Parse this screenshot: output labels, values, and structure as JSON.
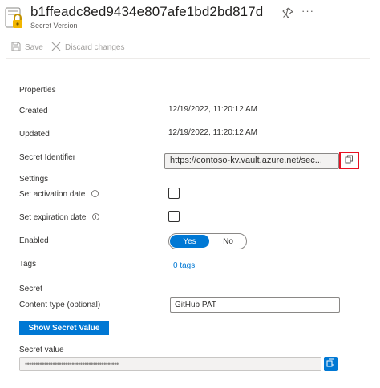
{
  "header": {
    "title": "b1ffeadc8ed9434e807afe1bd2bd817d",
    "subtitle": "Secret Version",
    "more_label": "···",
    "icon": "key-vault-secret-icon"
  },
  "toolbar": {
    "save_label": "Save",
    "discard_label": "Discard changes"
  },
  "properties": {
    "section_title": "Properties",
    "created_label": "Created",
    "created_value": "12/19/2022, 11:20:12 AM",
    "updated_label": "Updated",
    "updated_value": "12/19/2022, 11:20:12 AM",
    "identifier_label": "Secret Identifier",
    "identifier_value": "https://contoso-kv.vault.azure.net/sec..."
  },
  "settings": {
    "section_title": "Settings",
    "activation_label": "Set activation date",
    "activation_checked": false,
    "expiration_label": "Set expiration date",
    "expiration_checked": false,
    "enabled_label": "Enabled",
    "enabled_yes": "Yes",
    "enabled_no": "No",
    "enabled_value": "Yes",
    "tags_label": "Tags",
    "tags_value": "0 tags"
  },
  "secret": {
    "section_title": "Secret",
    "content_type_label": "Content type (optional)",
    "content_type_value": "GitHub PAT",
    "show_button_label": "Show Secret Value",
    "value_label": "Secret value",
    "value_masked": "••••••••••••••••••••••••••••••••••••••••••••"
  },
  "colors": {
    "accent": "#0078d4",
    "highlight": "#e81123",
    "key_icon": "#f2b600"
  }
}
